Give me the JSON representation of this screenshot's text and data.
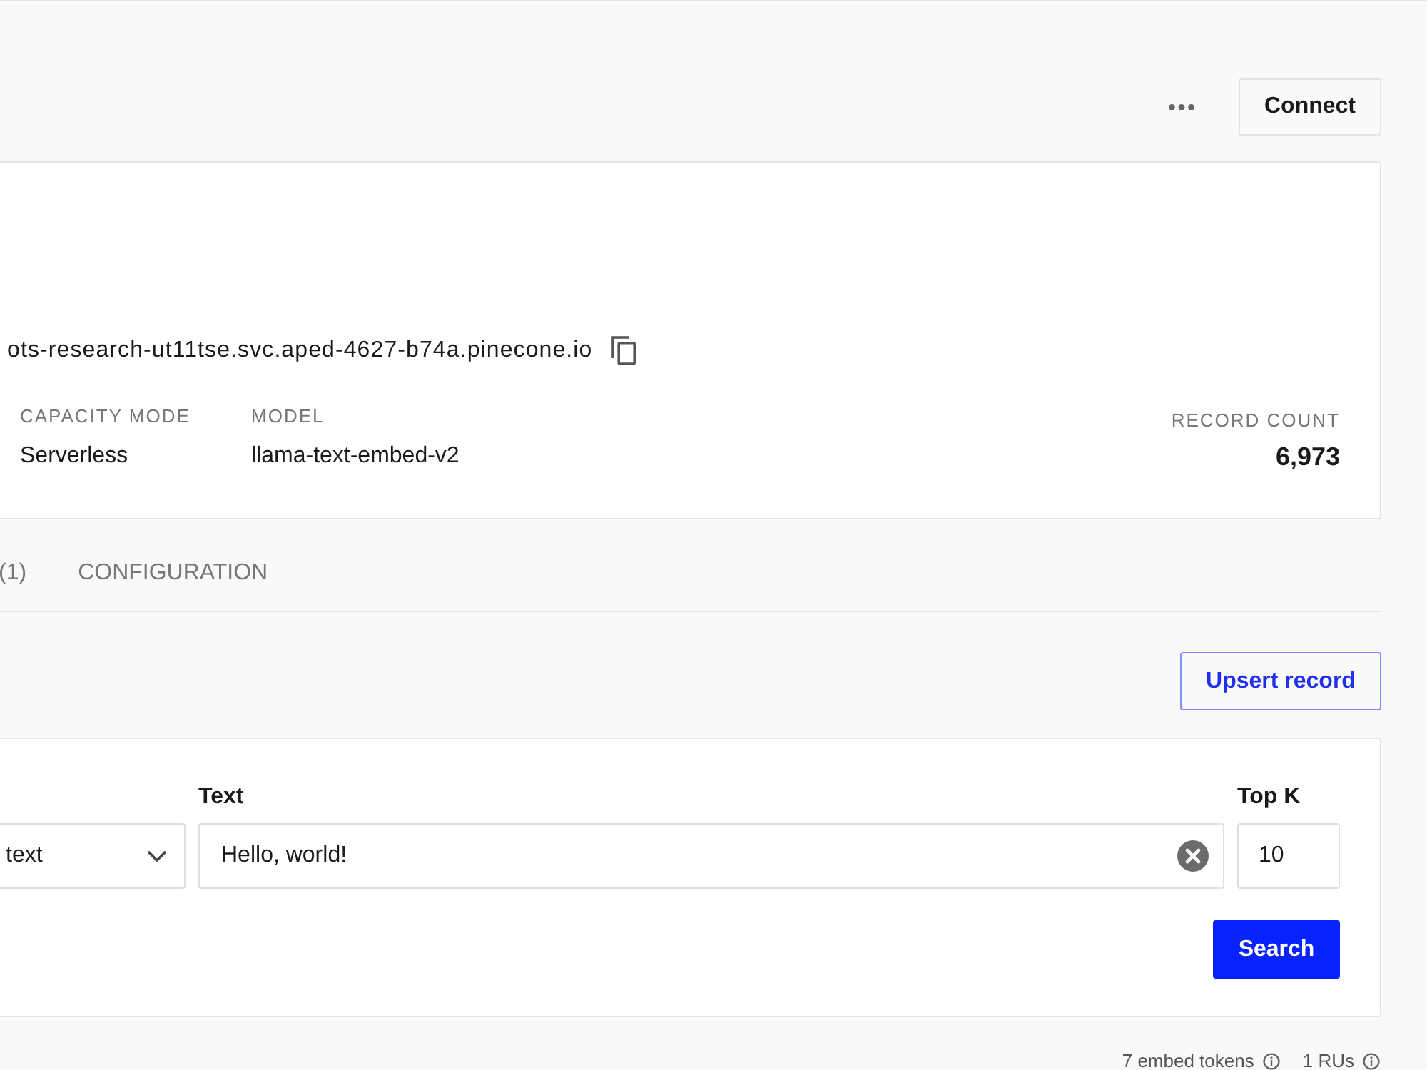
{
  "header": {
    "connect_button": "Connect"
  },
  "index_card": {
    "host": "ots-research-ut11tse.svc.aped-4627-b74a.pinecone.io",
    "stats": [
      {
        "label": "CAPACITY MODE",
        "value": "Serverless"
      },
      {
        "label": "MODEL",
        "value": "llama-text-embed-v2"
      }
    ],
    "record_count": {
      "label": "RECORD COUNT",
      "value": "6,973"
    }
  },
  "tabs": [
    {
      "label": "(1)",
      "selected": false
    },
    {
      "label": "CONFIGURATION",
      "selected": false
    }
  ],
  "upsert_button": "Upsert record",
  "search_card": {
    "select": {
      "value": "text"
    },
    "text_field": {
      "label": "Text",
      "value": "Hello, world!"
    },
    "top_k": {
      "label": "Top K",
      "value": "10"
    },
    "search_button": "Search"
  },
  "usage": [
    {
      "text": "7 embed tokens"
    },
    {
      "text": "1 RUs"
    }
  ]
}
